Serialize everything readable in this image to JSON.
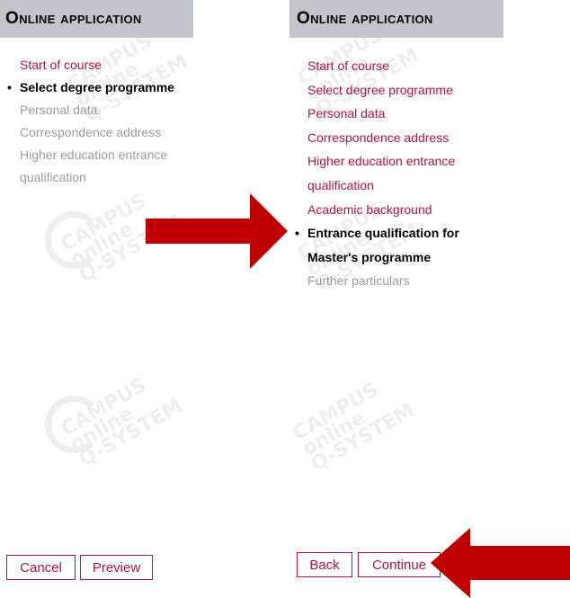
{
  "left_panel": {
    "title": "Online application",
    "steps": [
      {
        "label": "Start of course"
      },
      {
        "label": "Select degree programme"
      },
      {
        "label": "Personal data"
      },
      {
        "label": "Correspondence address"
      },
      {
        "label": "Higher education entrance"
      },
      {
        "label": "qualification"
      }
    ],
    "buttons": {
      "cancel": "Cancel",
      "preview": "Preview"
    }
  },
  "right_panel": {
    "title": "Online application",
    "steps": [
      {
        "label": "Start of course"
      },
      {
        "label": "Select degree programme"
      },
      {
        "label": "Personal data"
      },
      {
        "label": "Correspondence address"
      },
      {
        "label": "Higher education entrance"
      },
      {
        "label": "qualification"
      },
      {
        "label": "Academic background"
      },
      {
        "label": "Entrance qualification for"
      },
      {
        "label": "Master's programme"
      },
      {
        "label": "Further particulars"
      }
    ],
    "buttons": {
      "back": "Back",
      "continue": "Continue"
    }
  },
  "watermark": {
    "line1": "CAMPUS",
    "line2": "online",
    "line3": "Q-SYSTEM"
  },
  "colors": {
    "header_bg": "#c2c6cc",
    "link": "#b5123e",
    "disabled": "#9b9b9b",
    "arrow": "#c00000"
  },
  "icons": [
    "right-arrow-icon",
    "left-arrow-icon",
    "bullet-icon"
  ]
}
